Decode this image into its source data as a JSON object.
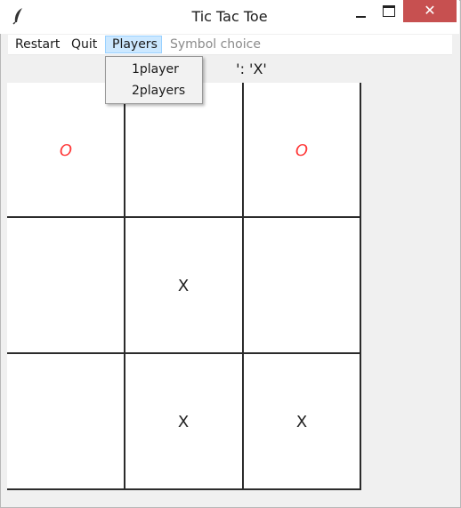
{
  "window": {
    "title": "Tic Tac Toe",
    "close_glyph": "✕"
  },
  "menu": {
    "restart": "Restart",
    "quit": "Quit",
    "players": "Players",
    "symbol_choice": "Symbol choice"
  },
  "players_menu": {
    "items": [
      "1player",
      "2players"
    ]
  },
  "status": {
    "text": "': 'X'"
  },
  "board": {
    "cells": [
      "O",
      "",
      "O",
      "",
      "X",
      "",
      "",
      "X",
      "X"
    ]
  },
  "colors": {
    "o_mark": "#ff3b3b",
    "x_mark": "#222222",
    "close_button": "#c75050",
    "menu_highlight": "#cce8ff"
  }
}
